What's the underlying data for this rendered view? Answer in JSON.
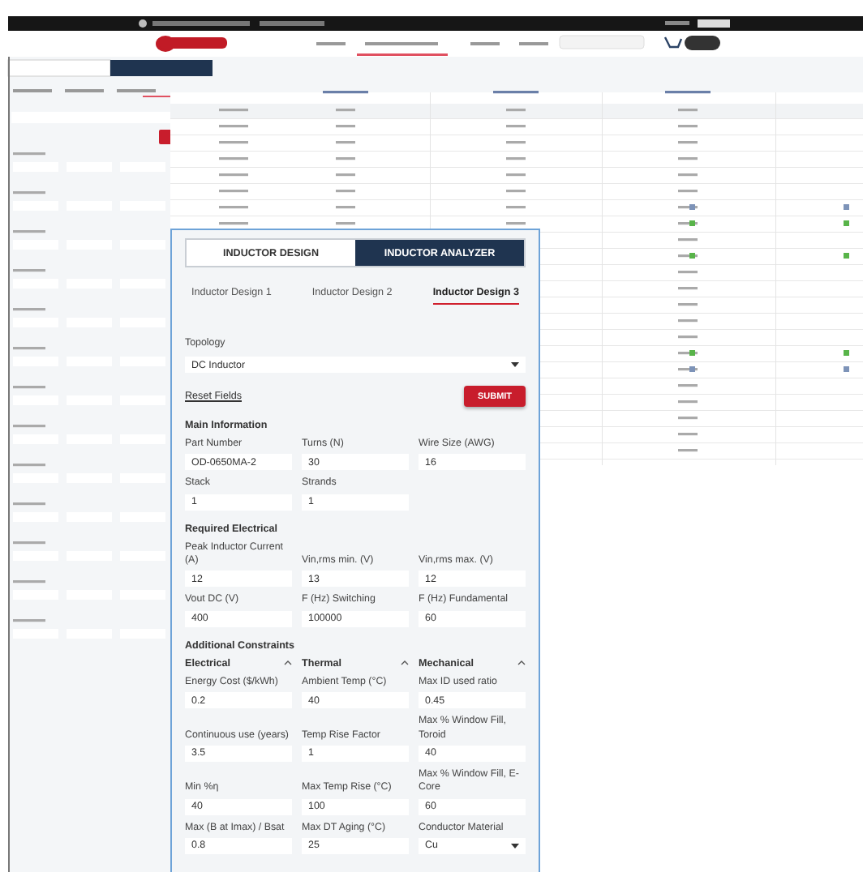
{
  "inset": {
    "tabs": [
      {
        "label": "INDUCTOR DESIGN",
        "selected": false
      },
      {
        "label": "INDUCTOR ANALYZER",
        "selected": true
      }
    ],
    "design_tabs": [
      {
        "label": "Inductor Design 1",
        "selected": false
      },
      {
        "label": "Inductor Design 2",
        "selected": false
      },
      {
        "label": "Inductor Design 3",
        "selected": true
      }
    ],
    "topology": {
      "label": "Topology",
      "value": "DC Inductor"
    },
    "reset_link": "Reset Fields",
    "submit_button": "SUBMIT",
    "sections": [
      {
        "title": "Main Information",
        "fields": [
          {
            "label": "Part Number",
            "value": "OD-0650MA-2",
            "kind": "input"
          },
          {
            "label": "Turns (N)",
            "value": "30",
            "kind": "input"
          },
          {
            "label": "Wire Size (AWG)",
            "value": "16",
            "kind": "input"
          },
          {
            "label": "Stack",
            "value": "1",
            "kind": "input"
          },
          {
            "label": "Strands",
            "value": "1",
            "kind": "input"
          }
        ]
      },
      {
        "title": "Required Electrical",
        "fields": [
          {
            "label": "Peak Inductor Current (A)",
            "value": "12",
            "kind": "input"
          },
          {
            "label": "Vin,rms min. (V)",
            "value": "13",
            "kind": "input"
          },
          {
            "label": "Vin,rms max. (V)",
            "value": "12",
            "kind": "input"
          },
          {
            "label": "Vout DC (V)",
            "value": "400",
            "kind": "input"
          },
          {
            "label": "F (Hz) Switching",
            "value": "100000",
            "kind": "input"
          },
          {
            "label": "F (Hz) Fundamental",
            "value": "60",
            "kind": "input"
          }
        ]
      },
      {
        "title": "Additional Constraints",
        "groups": [
          {
            "label": "Electrical",
            "expanded": true
          },
          {
            "label": "Thermal",
            "expanded": true
          },
          {
            "label": "Mechanical",
            "expanded": true
          }
        ],
        "fields": [
          {
            "label": "Energy Cost ($/kWh)",
            "value": "0.2",
            "kind": "input"
          },
          {
            "label": "Ambient Temp (°C)",
            "value": "40",
            "kind": "input"
          },
          {
            "label": "Max ID used ratio",
            "value": "0.45",
            "kind": "input"
          },
          {
            "label": "Continuous use (years)",
            "value": "3.5",
            "kind": "input"
          },
          {
            "label": "Temp Rise Factor",
            "value": "1",
            "kind": "input"
          },
          {
            "label": "Max % Window Fill, Toroid",
            "value": "40",
            "kind": "input"
          },
          {
            "label": "Min %η",
            "value": "40",
            "kind": "input"
          },
          {
            "label": "Max Temp Rise (°C)",
            "value": "100",
            "kind": "input"
          },
          {
            "label": "Max % Window Fill, E-Core",
            "value": "60",
            "kind": "input"
          },
          {
            "label": "Max (B at Imax) / Bsat",
            "value": "0.8",
            "kind": "input"
          },
          {
            "label": "Max DT Aging (°C)",
            "value": "25",
            "kind": "input"
          },
          {
            "label": "Conductor Material",
            "value": "Cu",
            "kind": "select"
          }
        ]
      }
    ]
  }
}
